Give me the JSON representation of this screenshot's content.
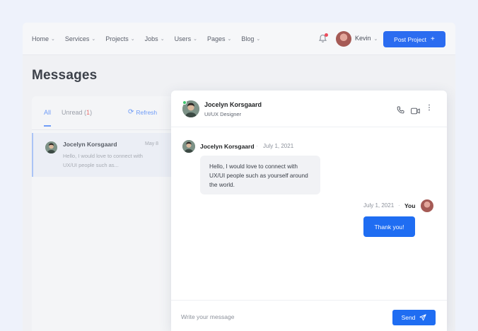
{
  "nav": {
    "items": [
      "Home",
      "Services",
      "Projects",
      "Jobs",
      "Users",
      "Pages",
      "Blog"
    ],
    "user_name": "Kevin",
    "post_button": "Post Project",
    "post_button_icon": "+"
  },
  "page": {
    "title": "Messages"
  },
  "inbox": {
    "tab_all": "All",
    "tab_unread": "Unread",
    "unread_count": "1",
    "refresh_label": "Refresh",
    "conversations": [
      {
        "name": "Jocelyn Korsgaard",
        "date": "May 8",
        "preview": "Hello, I would love to connect with UX/UI people such as..."
      }
    ]
  },
  "chat": {
    "contact_name": "Jocelyn Korsgaard",
    "contact_role": "UI/UX Designer",
    "messages": [
      {
        "sender": "Jocelyn Korsgaard",
        "date": "July 1, 2021",
        "text": "Hello, I would love to connect with UX/UI people such as yourself around the world."
      },
      {
        "sender": "You",
        "date": "July 1, 2021",
        "text": "Thank you!"
      }
    ],
    "separator": "·",
    "input_placeholder": "Write your message",
    "send_label": "Send"
  },
  "colors": {
    "primary": "#1f6df2",
    "online": "#3cc46c",
    "badge": "#ed4c5c",
    "background": "#eef2fb"
  },
  "icons": [
    "chevron-down-icon",
    "bell-icon",
    "plus-icon",
    "refresh-icon",
    "phone-icon",
    "video-icon",
    "more-vertical-icon",
    "send-icon"
  ]
}
